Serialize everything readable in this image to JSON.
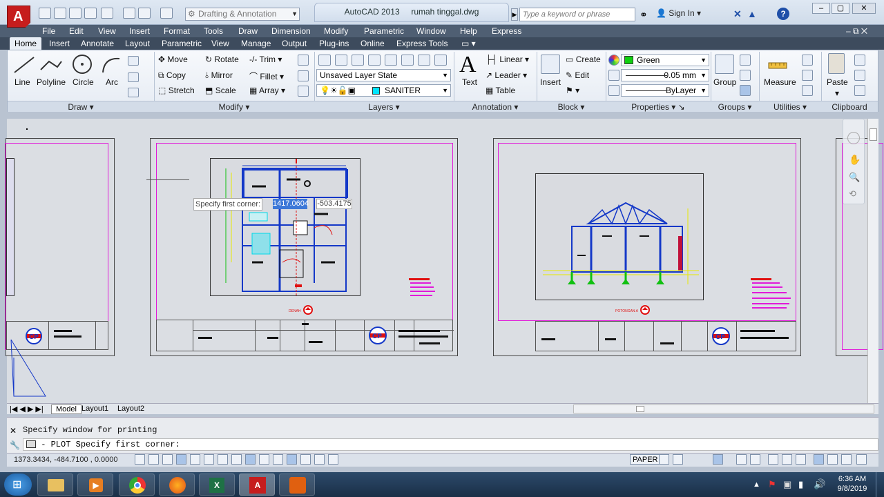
{
  "titlebar": {
    "workspace": "Drafting & Annotation",
    "app_title": "AutoCAD 2013",
    "file_name": "rumah tinggal.dwg",
    "search_placeholder": "Type a keyword or phrase",
    "signin": "Sign In"
  },
  "menu": [
    "File",
    "Edit",
    "View",
    "Insert",
    "Format",
    "Tools",
    "Draw",
    "Dimension",
    "Modify",
    "Parametric",
    "Window",
    "Help",
    "Express"
  ],
  "ribbon_tabs": [
    "Home",
    "Insert",
    "Annotate",
    "Layout",
    "Parametric",
    "View",
    "Manage",
    "Output",
    "Plug-ins",
    "Online",
    "Express Tools"
  ],
  "panels": {
    "draw": {
      "title": "Draw",
      "line": "Line",
      "polyline": "Polyline",
      "circle": "Circle",
      "arc": "Arc"
    },
    "modify": {
      "title": "Modify",
      "move": "Move",
      "rotate": "Rotate",
      "trim": "Trim",
      "copy": "Copy",
      "mirror": "Mirror",
      "fillet": "Fillet",
      "stretch": "Stretch",
      "scale": "Scale",
      "array": "Array"
    },
    "layers": {
      "title": "Layers",
      "layer_state": "Unsaved Layer State",
      "current_layer": "SANITER",
      "layer_color": "#00e5ff"
    },
    "annotation": {
      "title": "Annotation",
      "text": "Text",
      "linear": "Linear",
      "leader": "Leader",
      "table": "Table"
    },
    "block": {
      "title": "Block",
      "insert": "Insert",
      "create": "Create",
      "edit": "Edit"
    },
    "properties": {
      "title": "Properties",
      "color": "Green",
      "color_swatch": "#10d010",
      "lineweight": "0.05 mm",
      "linetype": "ByLayer"
    },
    "groups": {
      "title": "Groups",
      "group": "Group"
    },
    "utilities": {
      "title": "Utilities",
      "measure": "Measure"
    },
    "clipboard": {
      "title": "Clipboard",
      "paste": "Paste"
    }
  },
  "canvas": {
    "tooltip_label": "Specify first corner:",
    "coord_x": "1417.0604",
    "coord_y": "-503.4175",
    "denah_label": "DENAH",
    "potongan_label": "POTONGAN A"
  },
  "layout_tabs": [
    "Model",
    "Layout1",
    "Layout2"
  ],
  "command": {
    "history": "Specify window for printing",
    "prompt_icon": "printer-icon",
    "prompt": "- PLOT Specify first corner:"
  },
  "status": {
    "coordinates": "1373.3434, -484.7100 , 0.0000",
    "paper": "PAPER"
  },
  "taskbar": {
    "time": "6:36 AM",
    "date": "9/8/2019"
  },
  "colors": {
    "magenta": "#e11ad9",
    "blue": "#1438c8",
    "cyan": "#00d8e8",
    "red": "#e01010",
    "yellow": "#e8e800",
    "green": "#10c010"
  }
}
